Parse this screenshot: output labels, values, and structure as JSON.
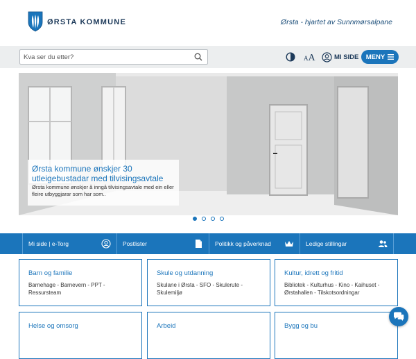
{
  "header": {
    "logo_text": "ØRSTA KOMMUNE",
    "tagline": "Ørsta - hjartet av Sunnmørsalpane"
  },
  "toolbar": {
    "search_placeholder": "Kva ser du etter?",
    "fontsize_small": "A",
    "fontsize_big": "A",
    "mypage_label": "MI SIDE",
    "menu_label": "MENY"
  },
  "hero": {
    "title": "Ørsta kommune ønskjer 30 utleigebustadar med tilvisingsavtale",
    "text": "Ørsta kommune ønskjer å inngå tilvisingsavtale med ein eller fleire utbyggjarar som har som..",
    "slides": 4,
    "active_slide": 1
  },
  "quicklinks": [
    {
      "label": "Mi side | e-Torg",
      "icon": "user-circle-icon"
    },
    {
      "label": "Postlister",
      "icon": "document-icon"
    },
    {
      "label": "Politikk og påverknad",
      "icon": "crown-icon"
    },
    {
      "label": "Ledige stillingar",
      "icon": "users-icon"
    }
  ],
  "categories": [
    {
      "title": "Barn og familie",
      "text": "Barnehage - Barnevern - PPT - Ressursteam"
    },
    {
      "title": "Skule og utdanning",
      "text": "Skulane i Ørsta - SFO - Skulerute - Skulemiljø"
    },
    {
      "title": "Kultur, idrett og fritid",
      "text": "Bibliotek - Kulturhus - Kino - Kaihuset - Ørstahallen - Tilskotsordningar"
    },
    {
      "title": "Helse og omsorg",
      "text": ""
    },
    {
      "title": "Arbeid",
      "text": ""
    },
    {
      "title": "Bygg og bu",
      "text": ""
    }
  ],
  "colors": {
    "accent": "#1b75bb",
    "toolbar_bg": "#eceeef"
  }
}
